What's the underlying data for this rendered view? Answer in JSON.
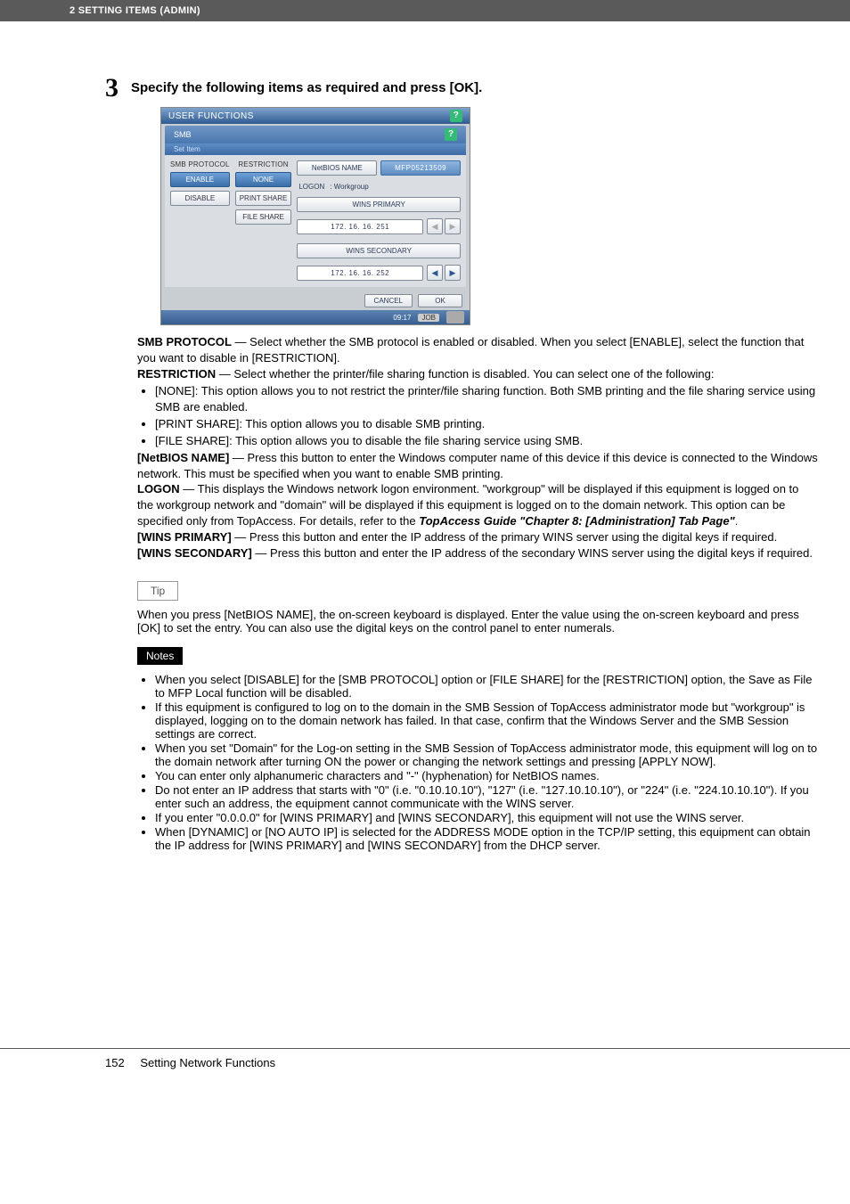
{
  "header": {
    "breadcrumb": "2 SETTING ITEMS (ADMIN)"
  },
  "step": {
    "number": "3",
    "title": "Specify the following items as required and press [OK]."
  },
  "mfp": {
    "windowTitle": "USER FUNCTIONS",
    "tab": "SMB",
    "subTab": "Set Item",
    "col1": {
      "header": "SMB PROTOCOL",
      "enable": "ENABLE",
      "disable": "DISABLE"
    },
    "col2": {
      "header": "RESTRICTION",
      "none": "NONE",
      "printShare": "PRINT SHARE",
      "fileShare": "FILE SHARE"
    },
    "col3": {
      "netbiosBtn": "NetBIOS NAME",
      "netbiosVal": "MFP05213509",
      "logonLabel": "LOGON",
      "logonValue": ": Workgroup",
      "winsPri": "WINS PRIMARY",
      "winsPriVal": "172. 16. 16. 251",
      "winsSec": "WINS SECONDARY",
      "winsSecVal": "172. 16. 16. 252"
    },
    "cancel": "CANCEL",
    "ok": "OK",
    "time": "09:17",
    "jobBadge": "JOB"
  },
  "desc": {
    "smb1a": "SMB PROTOCOL",
    "smb1b": " — Select whether the SMB protocol is enabled or disabled. When you select [ENABLE], select the function that you want to disable in [RESTRICTION].",
    "restr1a": "RESTRICTION",
    "restr1b": " — Select whether the printer/file sharing function is disabled. You can select one of the following:",
    "restrLi1": "[NONE]: This option allows you to not restrict the printer/file sharing function. Both SMB printing and the file sharing service using SMB are enabled.",
    "restrLi2": "[PRINT SHARE]: This option allows you to disable SMB printing.",
    "restrLi3": "[FILE SHARE]: This option allows you to disable the file sharing service using SMB.",
    "nb1a": "[NetBIOS NAME]",
    "nb1b": " — Press this button to enter the Windows computer name of this device if this device is connected to the Windows network. This must be specified when you want to enable SMB printing.",
    "logon1a": "LOGON",
    "logon1b": " — This displays the Windows network logon environment. \"workgroup\" will be displayed if this equipment is logged on to the workgroup network and \"domain\" will be displayed if this equipment is logged on to the domain network. This option can be specified only from TopAccess. For details, refer to the ",
    "logonRef": "TopAccess Guide \"Chapter 8: [Administration] Tab Page\"",
    "logonEnd": ".",
    "wp1a": "[WINS PRIMARY]",
    "wp1b": " — Press this button and enter the IP address of the primary WINS server using the digital keys if required.",
    "ws1a": "[WINS SECONDARY]",
    "ws1b": " — Press this button and enter the IP address of the secondary WINS server using the digital keys if required."
  },
  "tip": {
    "label": "Tip",
    "text": "When you press [NetBIOS NAME], the on-screen keyboard is displayed. Enter the value using the on-screen keyboard and press [OK] to set the entry. You can also use the digital keys on the control panel to enter numerals."
  },
  "notes": {
    "label": "Notes",
    "li1": "When you select [DISABLE] for the [SMB PROTOCOL] option or [FILE SHARE] for the [RESTRICTION] option, the Save as File to MFP Local function will be disabled.",
    "li2": "If this equipment is configured to log on to the domain in the SMB Session of TopAccess administrator mode but \"workgroup\" is displayed, logging on to the domain network has failed. In that case, confirm that the Windows Server and the SMB Session settings are correct.",
    "li3": "When you set \"Domain\" for the Log-on setting in the SMB Session of TopAccess administrator mode, this equipment will log on to the domain network after turning ON the power or changing the network settings and pressing [APPLY NOW].",
    "li4": "You can enter only alphanumeric characters and \"-\" (hyphenation) for NetBIOS names.",
    "li5": "Do not enter an IP address that starts with \"0\" (i.e. \"0.10.10.10\"), \"127\" (i.e. \"127.10.10.10\"), or \"224\" (i.e. \"224.10.10.10\"). If you enter such an address, the equipment cannot communicate with the WINS server.",
    "li6": "If you enter \"0.0.0.0\" for [WINS PRIMARY] and [WINS SECONDARY], this equipment will not use the WINS server.",
    "li7": "When [DYNAMIC] or [NO AUTO IP] is selected for the ADDRESS MODE option in the TCP/IP setting, this equipment can obtain the IP address for [WINS PRIMARY] and [WINS SECONDARY] from the DHCP server."
  },
  "footer": {
    "pageNum": "152",
    "section": "Setting Network Functions"
  }
}
